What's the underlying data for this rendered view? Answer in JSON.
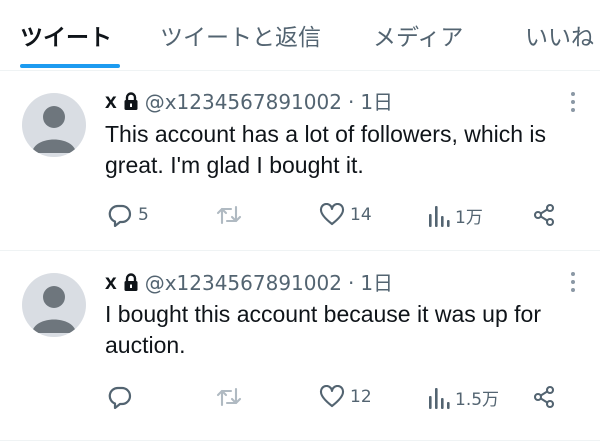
{
  "tabs": [
    {
      "label": "ツイート",
      "active": true
    },
    {
      "label": "ツイートと返信",
      "active": false
    },
    {
      "label": "メディア",
      "active": false
    },
    {
      "label": "いいね",
      "active": false
    }
  ],
  "colors": {
    "accent": "#1d9bf0",
    "text": "#0f1419",
    "secondary": "#536471",
    "divider": "#eff3f4"
  },
  "tweets": [
    {
      "name": "x",
      "handle": "@x1234567891002",
      "separator": "·",
      "time": "1日",
      "text": "This account has a lot of followers, which is great. I'm glad I bought it.",
      "replies": "5",
      "retweets": "",
      "likes": "14",
      "views": "1万",
      "icons": [
        "avatar-placeholder",
        "lock-icon",
        "more-vertical-icon",
        "reply-icon",
        "retweet-icon",
        "like-icon",
        "views-icon",
        "share-icon"
      ]
    },
    {
      "name": "x",
      "handle": "@x1234567891002",
      "separator": "·",
      "time": "1日",
      "text": "I bought this account because it was up for auction.",
      "replies": "",
      "retweets": "",
      "likes": "12",
      "views": "1.5万",
      "icons": [
        "avatar-placeholder",
        "lock-icon",
        "more-vertical-icon",
        "reply-icon",
        "retweet-icon",
        "like-icon",
        "views-icon",
        "share-icon"
      ]
    }
  ]
}
